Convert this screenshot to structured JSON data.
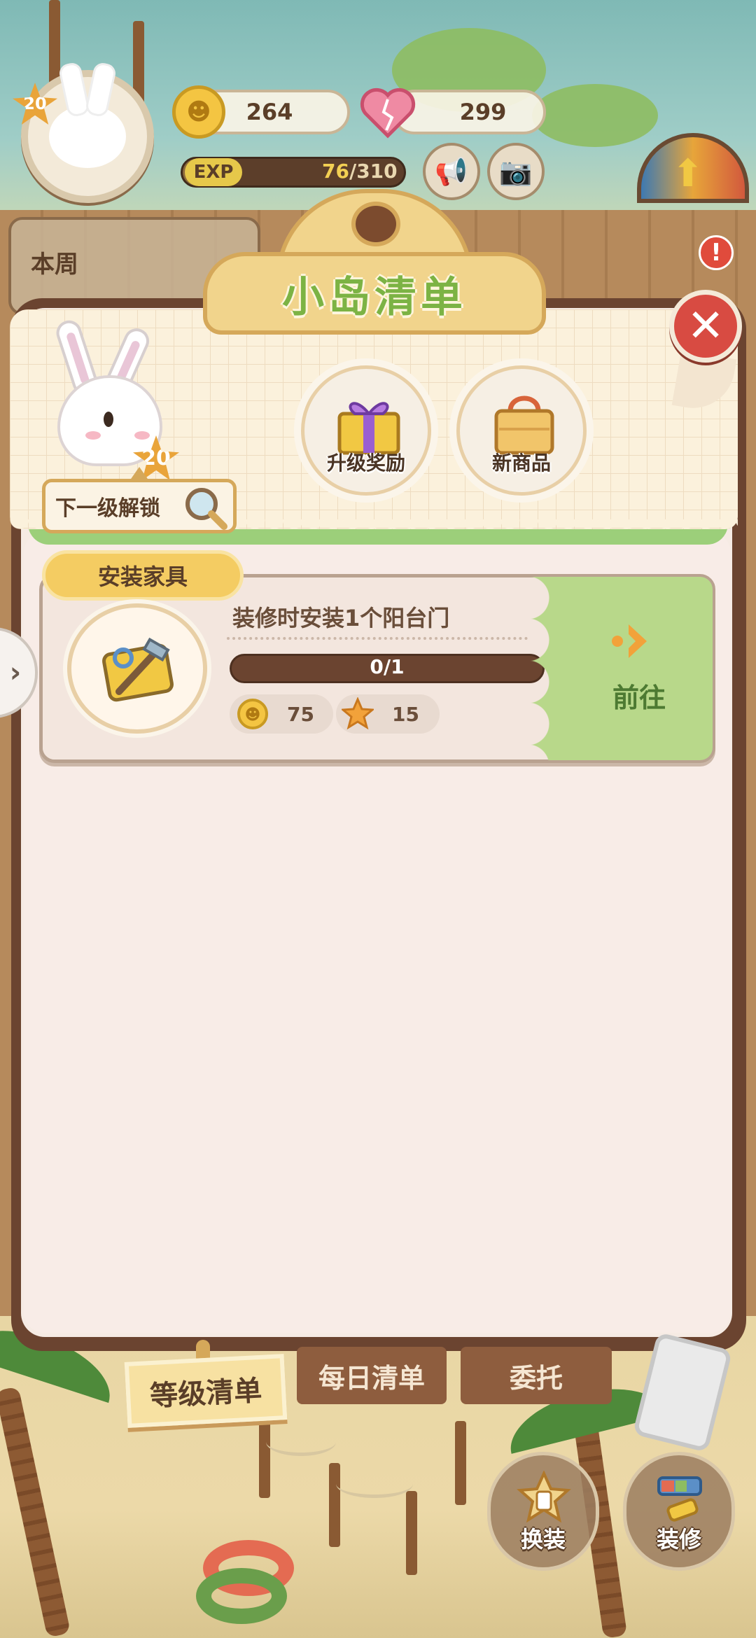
{
  "hud": {
    "level": "20",
    "coins": "264",
    "hearts": "299",
    "exp_label": "EXP",
    "exp_current": "76",
    "exp_total": "/310",
    "exp_progress": 0.245,
    "side_notification": "本周"
  },
  "dialog": {
    "title": "小岛清单",
    "close_glyph": "✕",
    "next_unlock_label": "下一级解锁",
    "next_level": "20",
    "rewards": [
      {
        "label": "升级奖励",
        "icon": "gift-box-icon"
      },
      {
        "label": "新商品",
        "icon": "shopping-bag-icon"
      }
    ]
  },
  "section": {
    "tag": "安装家具"
  },
  "task": {
    "title": "装修时安装1个阳台门",
    "progress_text": "0/1",
    "progress": 0,
    "reward_coin": "75",
    "reward_star": "15",
    "go_label": "前往",
    "icon": "toolbox-icon"
  },
  "tabs": {
    "active": "等级清单",
    "daily": "每日清单",
    "commission": "委托"
  },
  "actions": {
    "dress": "换装",
    "decorate": "装修"
  },
  "side_arrow": "›",
  "alert_badge": "!",
  "colors": {
    "accent_green": "#7cb344",
    "close_red": "#d84b42",
    "frame_brown": "#6b4430",
    "progress_yellow": "#f2cf53"
  }
}
